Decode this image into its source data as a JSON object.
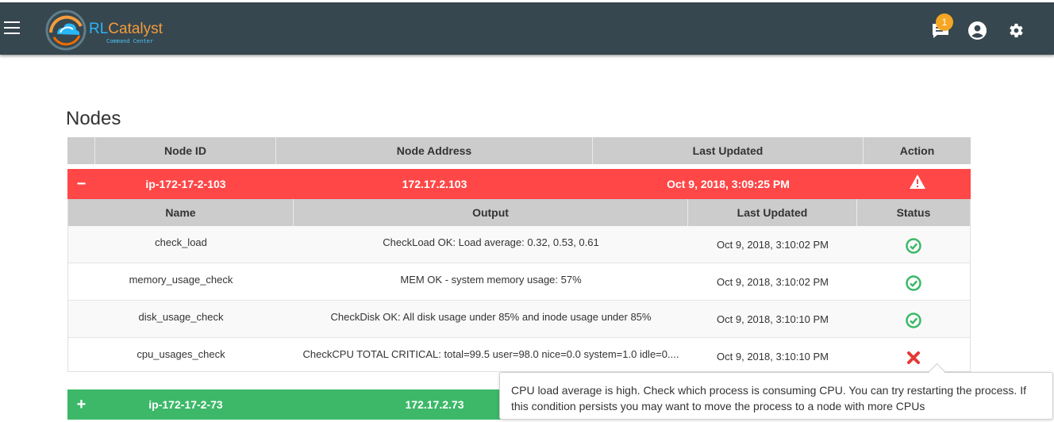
{
  "app": {
    "brand_part1": "RL",
    "brand_part2": "Catalyst",
    "brand_sub": "Command Center",
    "notification_count": "1",
    "colors": {
      "topbar": "#37474f",
      "error_row": "#ff4747",
      "ok_row": "#3cb868",
      "ok_icon": "#3cb868",
      "error_icon": "#e53935",
      "badge": "#f5a623"
    }
  },
  "page": {
    "title": "Nodes"
  },
  "nodes_table": {
    "headers": [
      "",
      "Node ID",
      "Node Address",
      "Last Updated",
      "Action"
    ],
    "nodes": [
      {
        "toggle": "−",
        "id": "ip-172-17-2-103",
        "address": "172.17.2.103",
        "last_updated": "Oct 9, 2018, 3:09:25 PM",
        "action_icon": "warning-icon",
        "status": "critical",
        "checks_headers": [
          "Name",
          "Output",
          "Last Updated",
          "Status"
        ],
        "checks": [
          {
            "name": "check_load",
            "output": "CheckLoad OK: Load average: 0.32, 0.53, 0.61",
            "last_updated": "Oct 9, 2018, 3:10:02 PM",
            "status": "ok"
          },
          {
            "name": "memory_usage_check",
            "output": "MEM OK - system memory usage: 57%",
            "last_updated": "Oct 9, 2018, 3:10:02 PM",
            "status": "ok"
          },
          {
            "name": "disk_usage_check",
            "output": "CheckDisk OK: All disk usage under 85% and inode usage under 85%",
            "last_updated": "Oct 9, 2018, 3:10:10 PM",
            "status": "ok"
          },
          {
            "name": "cpu_usages_check",
            "output": "CheckCPU TOTAL CRITICAL: total=99.5 user=98.0 nice=0.0 system=1.0 idle=0....",
            "last_updated": "Oct 9, 2018, 3:10:10 PM",
            "status": "critical"
          }
        ]
      },
      {
        "toggle": "+",
        "id": "ip-172-17-2-73",
        "address": "172.17.2.73",
        "status": "ok"
      }
    ]
  },
  "tooltip": {
    "text": "CPU load average is high. Check which process is consuming CPU. You can try restarting the process. If this condition persists you may want to move the process to a node with more CPUs"
  }
}
